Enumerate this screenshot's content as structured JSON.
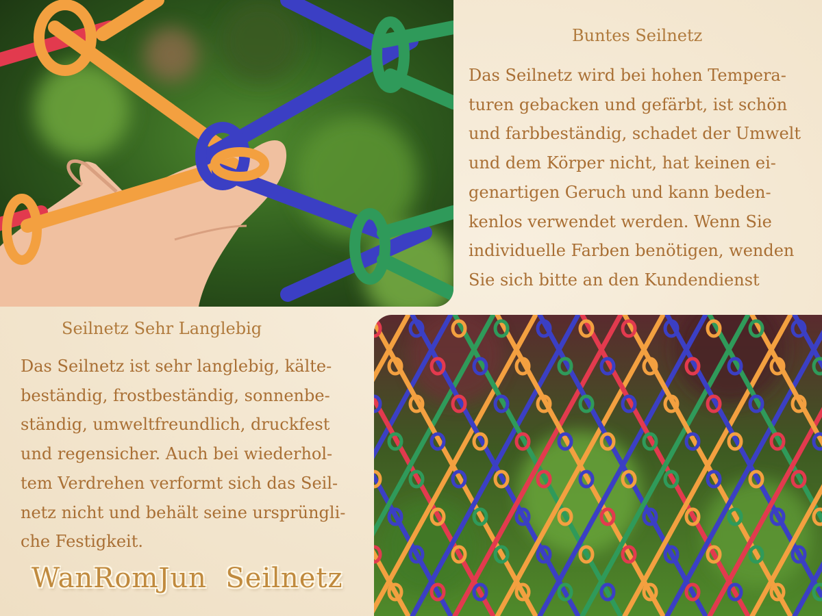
{
  "section_right": {
    "title": "Buntes Seilnetz",
    "lines": [
      "Das Seilnetz wird bei hohen Tempera-",
      "turen gebacken und gefärbt, ist schön",
      "und farbbeständig, schadet der Umwelt",
      "und dem Körper nicht, hat keinen ei-",
      "genartigen Geruch und kann beden-",
      "kenlos verwendet werden. Wenn Sie",
      "individuelle Farben benötigen, wenden",
      "Sie sich bitte an den Kundendienst"
    ]
  },
  "section_left": {
    "title": "Seilnetz Sehr Langlebig",
    "lines": [
      "Das Seilnetz ist sehr langlebig, kälte-",
      "beständig, frostbeständig, sonnenbe-",
      "ständig, umweltfreundlich, druckfest",
      "und regensicher. Auch bei wiederhol-",
      "tem Verdrehen verformt sich das Seil-",
      "netz nicht und behält seine ursprüngli-",
      "che Festigkeit."
    ]
  },
  "brand": "WanRomJun  Seilnetz",
  "colors": {
    "text": "#a96f34",
    "rope_red": "#e23a4e",
    "rope_orange": "#f3a040",
    "rope_blue": "#3b3fc4",
    "rope_green": "#2f9a5a",
    "background": "#f5e9d4"
  }
}
